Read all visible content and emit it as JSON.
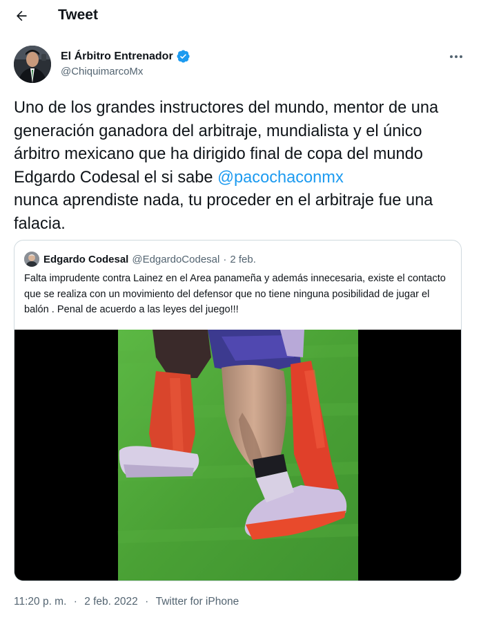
{
  "header": {
    "title": "Tweet"
  },
  "tweet": {
    "author": {
      "name": "El Árbitro Entrenador",
      "handle": "@ChiquimarcoMx",
      "verified": true
    },
    "text_before": "Uno de los grandes instructores del mundo, mentor de una generación ganadora del arbitraje, mundialista y el único árbitro mexicano que ha dirigido final de copa del mundo Edgardo Codesal el si sabe ",
    "mention": "@pacochaconmx",
    "text_after": "\nnunca aprendiste nada, tu proceder en el arbitraje fue una falacia.",
    "time": "11:20 p. m.",
    "date": "2 feb. 2022",
    "source": "Twitter for iPhone",
    "separator": "·"
  },
  "quoted": {
    "author_name": "Edgardo Codesal",
    "handle": "@EdgardoCodesal",
    "separator": "·",
    "date": "2 feb.",
    "text": "Falta imprudente contra Lainez en el Area panameña y además innecesaria, existe el contacto que se realiza con un movimiento del defensor que no tiene ninguna posibilidad de jugar el balón . Penal de acuerdo a las leyes del juego!!!"
  },
  "icons": {
    "back": "arrow-left-icon",
    "verified": "verified-badge-icon",
    "more": "more-options-icon"
  },
  "colors": {
    "accent": "#1d9bf0",
    "text": "#0f1419",
    "secondary": "#536471",
    "border": "#cfd9de",
    "pitch": "#4fa83a",
    "sock": "#e0402a"
  }
}
